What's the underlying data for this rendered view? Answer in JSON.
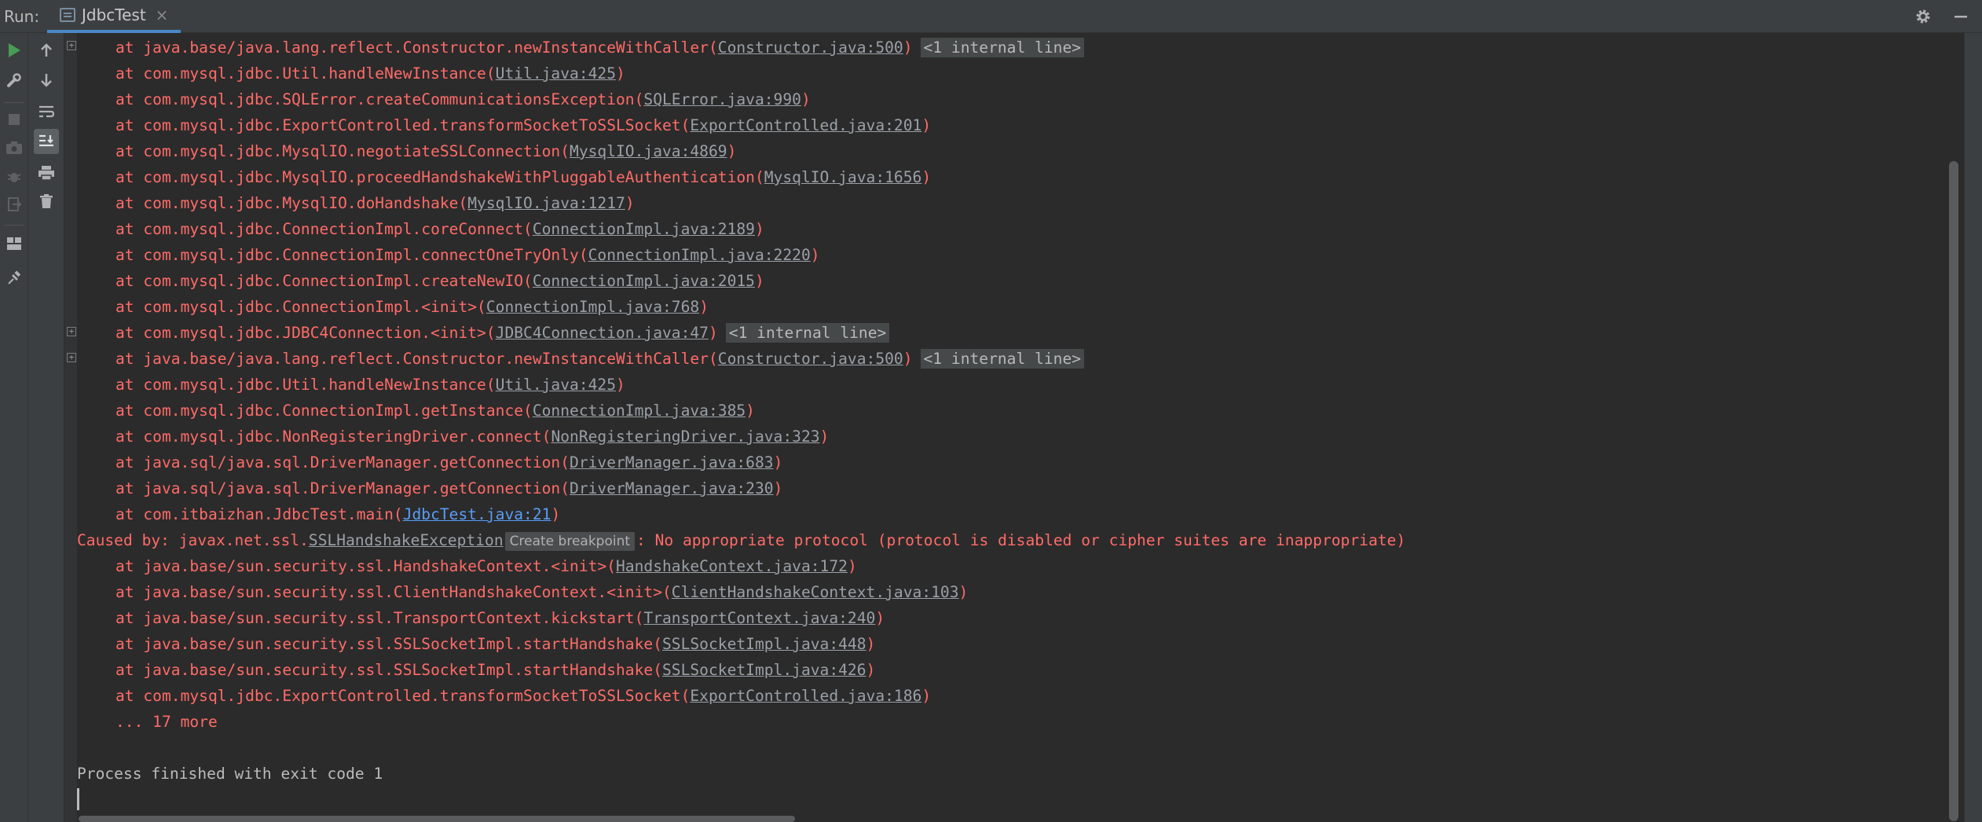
{
  "header": {
    "run_label": "Run:",
    "tab_label": "JdbcTest",
    "tab_close": "×",
    "settings_icon": "gear-icon",
    "minimize_icon": "minimize-icon"
  },
  "toolbar_left": [
    "rerun-icon",
    "wrench-icon",
    "stop-icon",
    "camera-icon",
    "debug-icon",
    "exit-icon",
    "layout-icon",
    "pin-icon"
  ],
  "toolbar_console": [
    "up-arrow-icon",
    "down-arrow-icon",
    "soft-wrap-icon",
    "scroll-to-end-icon",
    "print-icon",
    "trash-icon"
  ],
  "console": {
    "lines": [
      {
        "kind": "frame",
        "fold": true,
        "text": "at java.base/java.lang.reflect.Constructor.newInstanceWithCaller(",
        "link": "Constructor.java:500",
        "suffix": ")",
        "chip": "<1 internal line>"
      },
      {
        "kind": "frame",
        "fold": false,
        "text": "at com.mysql.jdbc.Util.handleNewInstance(",
        "link": "Util.java:425",
        "suffix": ")"
      },
      {
        "kind": "frame",
        "fold": false,
        "text": "at com.mysql.jdbc.SQLError.createCommunicationsException(",
        "link": "SQLError.java:990",
        "suffix": ")"
      },
      {
        "kind": "frame",
        "fold": false,
        "text": "at com.mysql.jdbc.ExportControlled.transformSocketToSSLSocket(",
        "link": "ExportControlled.java:201",
        "suffix": ")"
      },
      {
        "kind": "frame",
        "fold": false,
        "text": "at com.mysql.jdbc.MysqlIO.negotiateSSLConnection(",
        "link": "MysqlIO.java:4869",
        "suffix": ")"
      },
      {
        "kind": "frame",
        "fold": false,
        "text": "at com.mysql.jdbc.MysqlIO.proceedHandshakeWithPluggableAuthentication(",
        "link": "MysqlIO.java:1656",
        "suffix": ")"
      },
      {
        "kind": "frame",
        "fold": false,
        "text": "at com.mysql.jdbc.MysqlIO.doHandshake(",
        "link": "MysqlIO.java:1217",
        "suffix": ")"
      },
      {
        "kind": "frame",
        "fold": false,
        "text": "at com.mysql.jdbc.ConnectionImpl.coreConnect(",
        "link": "ConnectionImpl.java:2189",
        "suffix": ")"
      },
      {
        "kind": "frame",
        "fold": false,
        "text": "at com.mysql.jdbc.ConnectionImpl.connectOneTryOnly(",
        "link": "ConnectionImpl.java:2220",
        "suffix": ")"
      },
      {
        "kind": "frame",
        "fold": false,
        "text": "at com.mysql.jdbc.ConnectionImpl.createNewIO(",
        "link": "ConnectionImpl.java:2015",
        "suffix": ")"
      },
      {
        "kind": "frame",
        "fold": false,
        "text": "at com.mysql.jdbc.ConnectionImpl.<init>(",
        "link": "ConnectionImpl.java:768",
        "suffix": ")"
      },
      {
        "kind": "frame",
        "fold": true,
        "text": "at com.mysql.jdbc.JDBC4Connection.<init>(",
        "link": "JDBC4Connection.java:47",
        "suffix": ")",
        "chip": "<1 internal line>"
      },
      {
        "kind": "frame",
        "fold": true,
        "text": "at java.base/java.lang.reflect.Constructor.newInstanceWithCaller(",
        "link": "Constructor.java:500",
        "suffix": ")",
        "chip": "<1 internal line>"
      },
      {
        "kind": "frame",
        "fold": false,
        "text": "at com.mysql.jdbc.Util.handleNewInstance(",
        "link": "Util.java:425",
        "suffix": ")"
      },
      {
        "kind": "frame",
        "fold": false,
        "text": "at com.mysql.jdbc.ConnectionImpl.getInstance(",
        "link": "ConnectionImpl.java:385",
        "suffix": ")"
      },
      {
        "kind": "frame",
        "fold": false,
        "text": "at com.mysql.jdbc.NonRegisteringDriver.connect(",
        "link": "NonRegisteringDriver.java:323",
        "suffix": ")"
      },
      {
        "kind": "frame",
        "fold": false,
        "text": "at java.sql/java.sql.DriverManager.getConnection(",
        "link": "DriverManager.java:683",
        "suffix": ")"
      },
      {
        "kind": "frame",
        "fold": false,
        "text": "at java.sql/java.sql.DriverManager.getConnection(",
        "link": "DriverManager.java:230",
        "suffix": ")"
      },
      {
        "kind": "frame",
        "fold": false,
        "text": "at com.itbaizhan.JdbcTest.main(",
        "link": "JdbcTest.java:21",
        "suffix": ")",
        "link_blue": true
      },
      {
        "kind": "caused",
        "text": "Caused by: javax.net.ssl.",
        "link": "SSLHandshakeException",
        "tooltip": "Create breakpoint",
        "suffix": ": No appropriate protocol (protocol is disabled or cipher suites are inappropriate)"
      },
      {
        "kind": "frame",
        "fold": false,
        "text": "at java.base/sun.security.ssl.HandshakeContext.<init>(",
        "link": "HandshakeContext.java:172",
        "suffix": ")"
      },
      {
        "kind": "frame",
        "fold": false,
        "text": "at java.base/sun.security.ssl.ClientHandshakeContext.<init>(",
        "link": "ClientHandshakeContext.java:103",
        "suffix": ")"
      },
      {
        "kind": "frame",
        "fold": false,
        "text": "at java.base/sun.security.ssl.TransportContext.kickstart(",
        "link": "TransportContext.java:240",
        "suffix": ")"
      },
      {
        "kind": "frame",
        "fold": false,
        "text": "at java.base/sun.security.ssl.SSLSocketImpl.startHandshake(",
        "link": "SSLSocketImpl.java:448",
        "suffix": ")"
      },
      {
        "kind": "frame",
        "fold": false,
        "text": "at java.base/sun.security.ssl.SSLSocketImpl.startHandshake(",
        "link": "SSLSocketImpl.java:426",
        "suffix": ")"
      },
      {
        "kind": "frame",
        "fold": false,
        "text": "at com.mysql.jdbc.ExportControlled.transformSocketToSSLSocket(",
        "link": "ExportControlled.java:186",
        "suffix": ")"
      },
      {
        "kind": "more",
        "text": "... 17 more"
      },
      {
        "kind": "blank",
        "text": ""
      },
      {
        "kind": "plain",
        "text": "Process finished with exit code 1"
      }
    ]
  },
  "colors": {
    "background": "#2b2b2b",
    "error_text": "#ff6b68",
    "link_gray": "#9aa0a6",
    "link_blue": "#589df6",
    "plain_text": "#bbbbbb",
    "run_green": "#499c54",
    "tab_underline": "#4a88c7"
  }
}
